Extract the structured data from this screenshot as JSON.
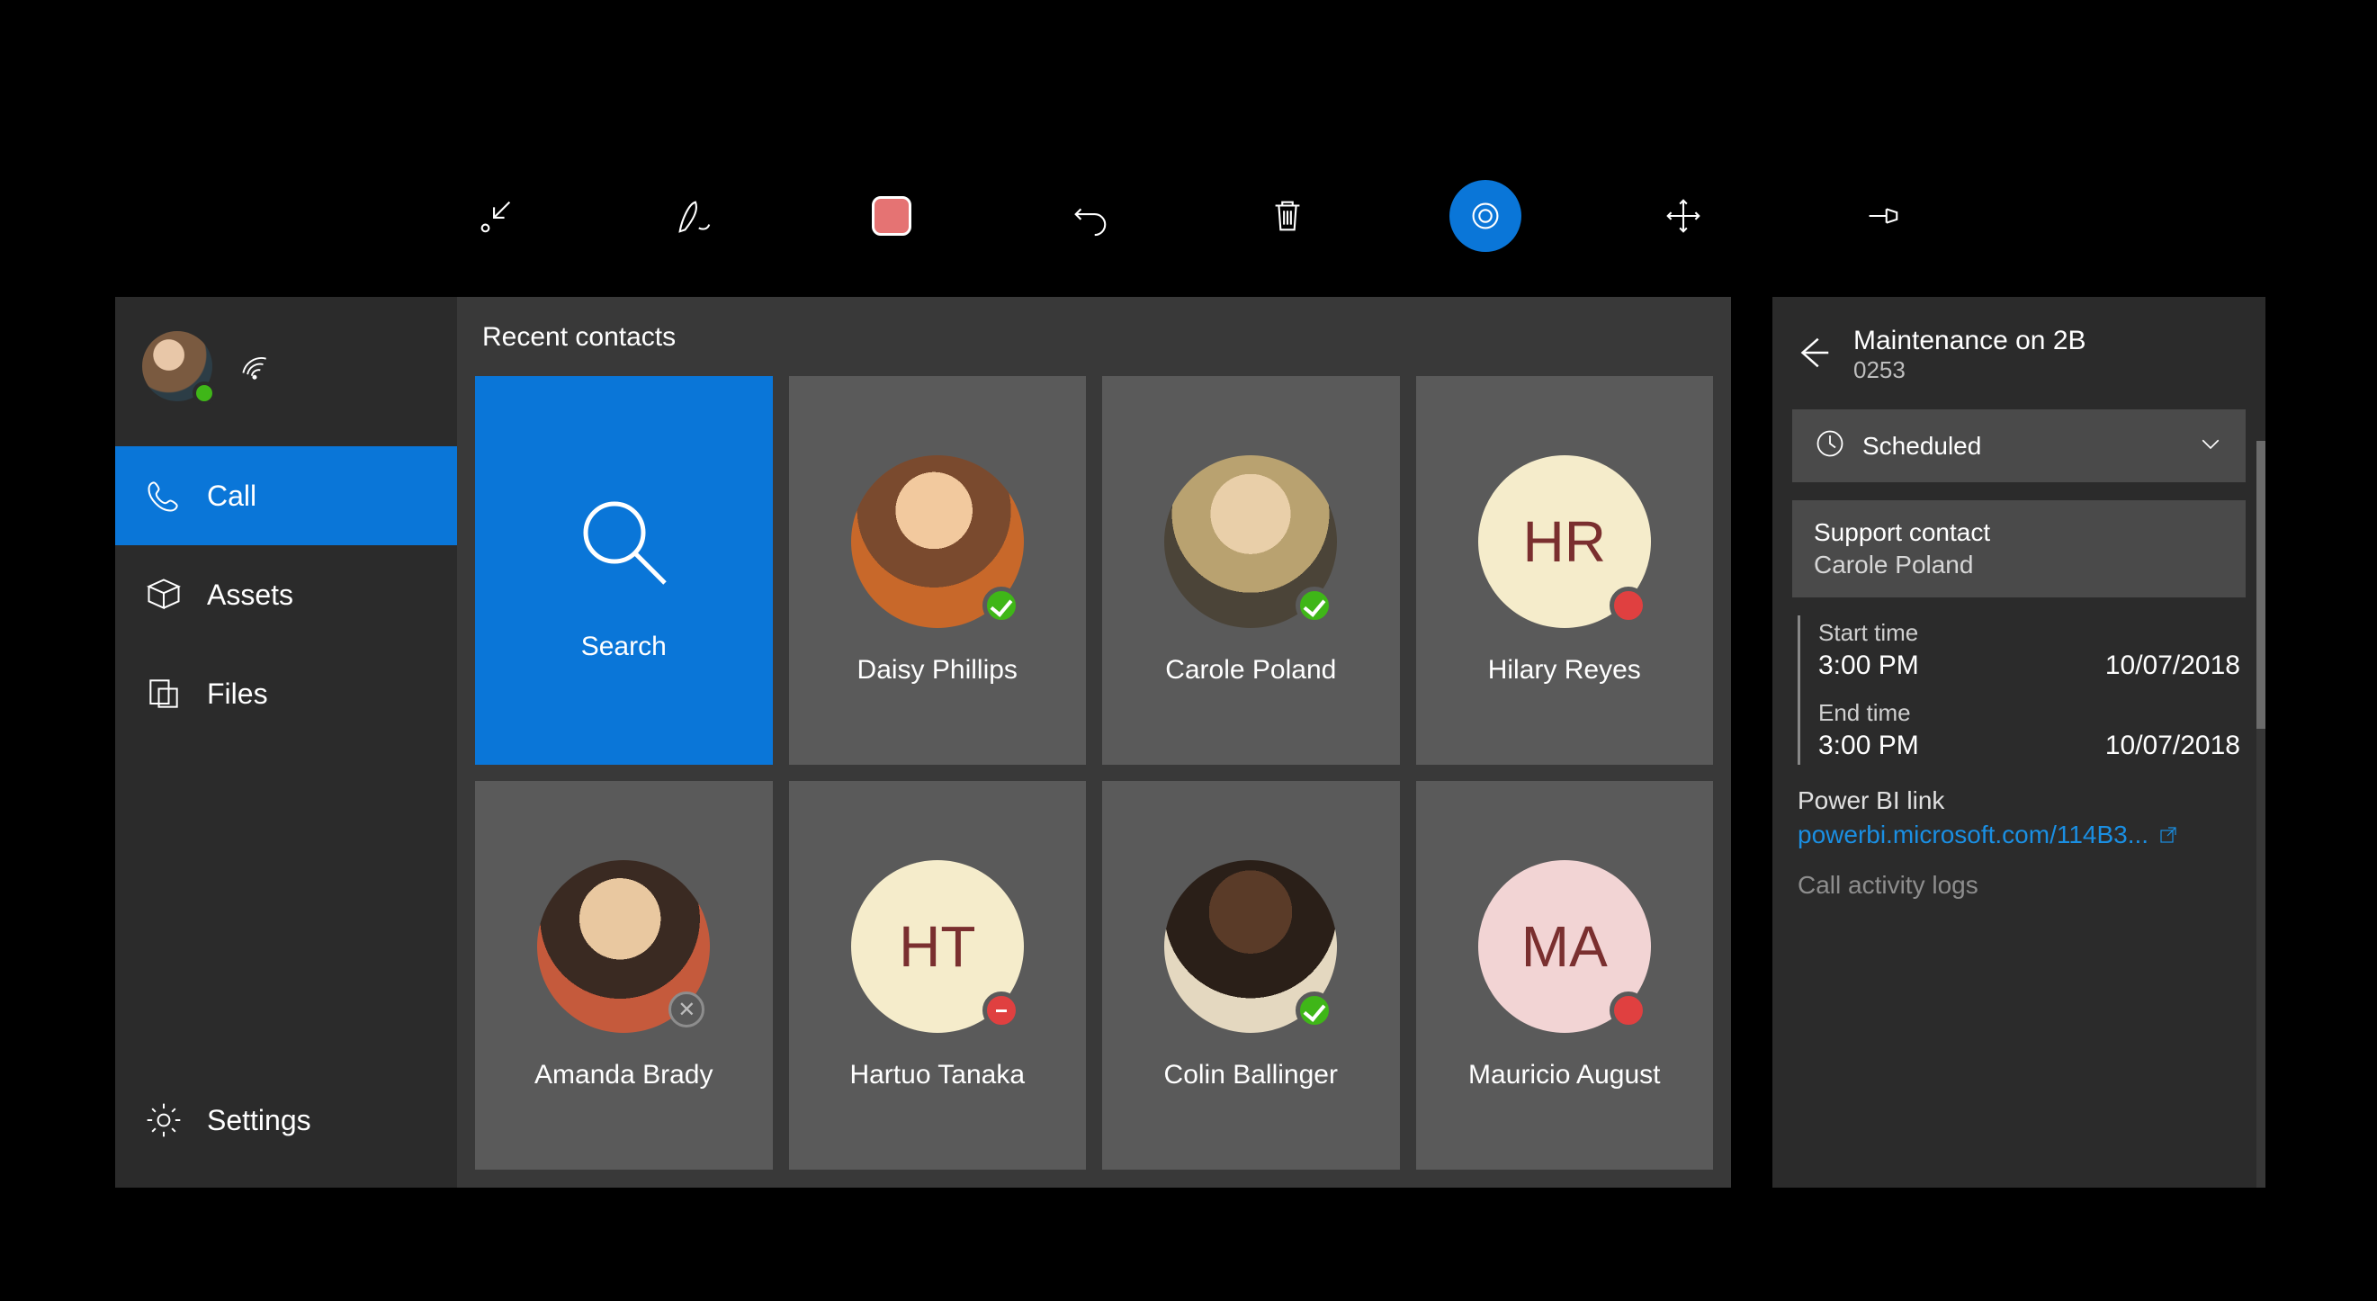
{
  "toolbar": {
    "icons": [
      "minimize-icon",
      "ink-icon",
      "stop-icon",
      "undo-icon",
      "trash-icon",
      "cortana-icon",
      "move-icon",
      "pin-icon"
    ],
    "activeIndex": 5
  },
  "sidebar": {
    "items": [
      {
        "id": "call",
        "label": "Call",
        "active": true
      },
      {
        "id": "assets",
        "label": "Assets",
        "active": false
      },
      {
        "id": "files",
        "label": "Files",
        "active": false
      }
    ],
    "settings_label": "Settings"
  },
  "contacts": {
    "title": "Recent contacts",
    "searchLabel": "Search",
    "list": [
      {
        "name": "Daisy Phillips",
        "status": "available",
        "type": "photo",
        "cls": "bg-photo1"
      },
      {
        "name": "Carole Poland",
        "status": "available",
        "type": "photo",
        "cls": "bg-photo2"
      },
      {
        "name": "Hilary Reyes",
        "status": "busy",
        "type": "initials",
        "initials": "HR",
        "cls": "bg-cream"
      },
      {
        "name": "Amanda Brady",
        "status": "offline",
        "type": "photo",
        "cls": "bg-photo3"
      },
      {
        "name": "Hartuo Tanaka",
        "status": "dnd",
        "type": "initials",
        "initials": "HT",
        "cls": "bg-cream"
      },
      {
        "name": "Colin Ballinger",
        "status": "available",
        "type": "photo",
        "cls": "bg-photo4"
      },
      {
        "name": "Mauricio August",
        "status": "busy",
        "type": "initials",
        "initials": "MA",
        "cls": "bg-pink"
      }
    ]
  },
  "detail": {
    "title": "Maintenance on 2B",
    "subtitle": "0253",
    "status": "Scheduled",
    "support_label": "Support contact",
    "support_name": "Carole Poland",
    "start_label": "Start time",
    "start_time": "3:00 PM",
    "start_date": "10/07/2018",
    "end_label": "End time",
    "end_time": "3:00 PM",
    "end_date": "10/07/2018",
    "link_label": "Power BI link",
    "link_text": "powerbi.microsoft.com/114B3...",
    "logs_label": "Call activity logs"
  }
}
